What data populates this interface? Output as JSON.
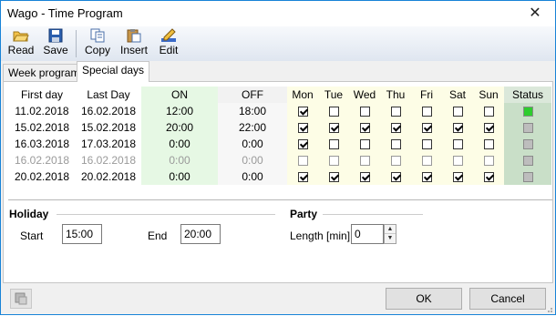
{
  "window": {
    "title": "Wago - Time Program",
    "close_glyph": "✕"
  },
  "toolbar": {
    "buttons": [
      {
        "label": "Read",
        "icon": "folder-open-icon"
      },
      {
        "label": "Save",
        "icon": "floppy-disk-icon"
      },
      {
        "label": "Copy",
        "icon": "copy-icon"
      },
      {
        "label": "Insert",
        "icon": "paste-icon"
      },
      {
        "label": "Edit",
        "icon": "edit-pencil-icon"
      }
    ]
  },
  "tabs": [
    {
      "label": "Week program",
      "active": false
    },
    {
      "label": "Special days",
      "active": true
    }
  ],
  "grid": {
    "headers": {
      "first_day": "First day",
      "last_day": "Last Day",
      "on": "ON",
      "off": "OFF",
      "days": [
        "Mon",
        "Tue",
        "Wed",
        "Thu",
        "Fri",
        "Sat",
        "Sun"
      ],
      "status": "Status"
    },
    "rows": [
      {
        "first_day": "11.02.2018",
        "last_day": "16.02.2018",
        "on": "12:00",
        "off": "18:00",
        "days": [
          true,
          false,
          false,
          false,
          false,
          false,
          false
        ],
        "status": "active",
        "dim": false
      },
      {
        "first_day": "15.02.2018",
        "last_day": "15.02.2018",
        "on": "20:00",
        "off": "22:00",
        "days": [
          true,
          true,
          true,
          true,
          true,
          true,
          true
        ],
        "status": "inactive",
        "dim": false
      },
      {
        "first_day": "16.03.2018",
        "last_day": "17.03.2018",
        "on": "0:00",
        "off": "0:00",
        "days": [
          true,
          false,
          false,
          false,
          false,
          false,
          false
        ],
        "status": "inactive",
        "dim": false
      },
      {
        "first_day": "16.02.2018",
        "last_day": "16.02.2018",
        "on": "0:00",
        "off": "0:00",
        "days": [
          false,
          false,
          false,
          false,
          false,
          false,
          false
        ],
        "status": "inactive",
        "dim": true
      },
      {
        "first_day": "20.02.2018",
        "last_day": "20.02.2018",
        "on": "0:00",
        "off": "0:00",
        "days": [
          true,
          true,
          true,
          true,
          true,
          true,
          true
        ],
        "status": "inactive",
        "dim": false
      }
    ],
    "status_colors": {
      "active": "#2ecc2e",
      "inactive": "#bdbdbd"
    }
  },
  "holiday": {
    "title": "Holiday",
    "start_label": "Start",
    "start_value": "15:00",
    "end_label": "End",
    "end_value": "20:00"
  },
  "party": {
    "title": "Party",
    "length_label": "Length [min]",
    "length_value": "0"
  },
  "buttons": {
    "ok": "OK",
    "cancel": "Cancel"
  },
  "colors": {
    "window_border": "#1883d7",
    "on_column": "#e6f8e4",
    "days_column": "#fdfde6",
    "status_column": "#c9dfc8"
  }
}
